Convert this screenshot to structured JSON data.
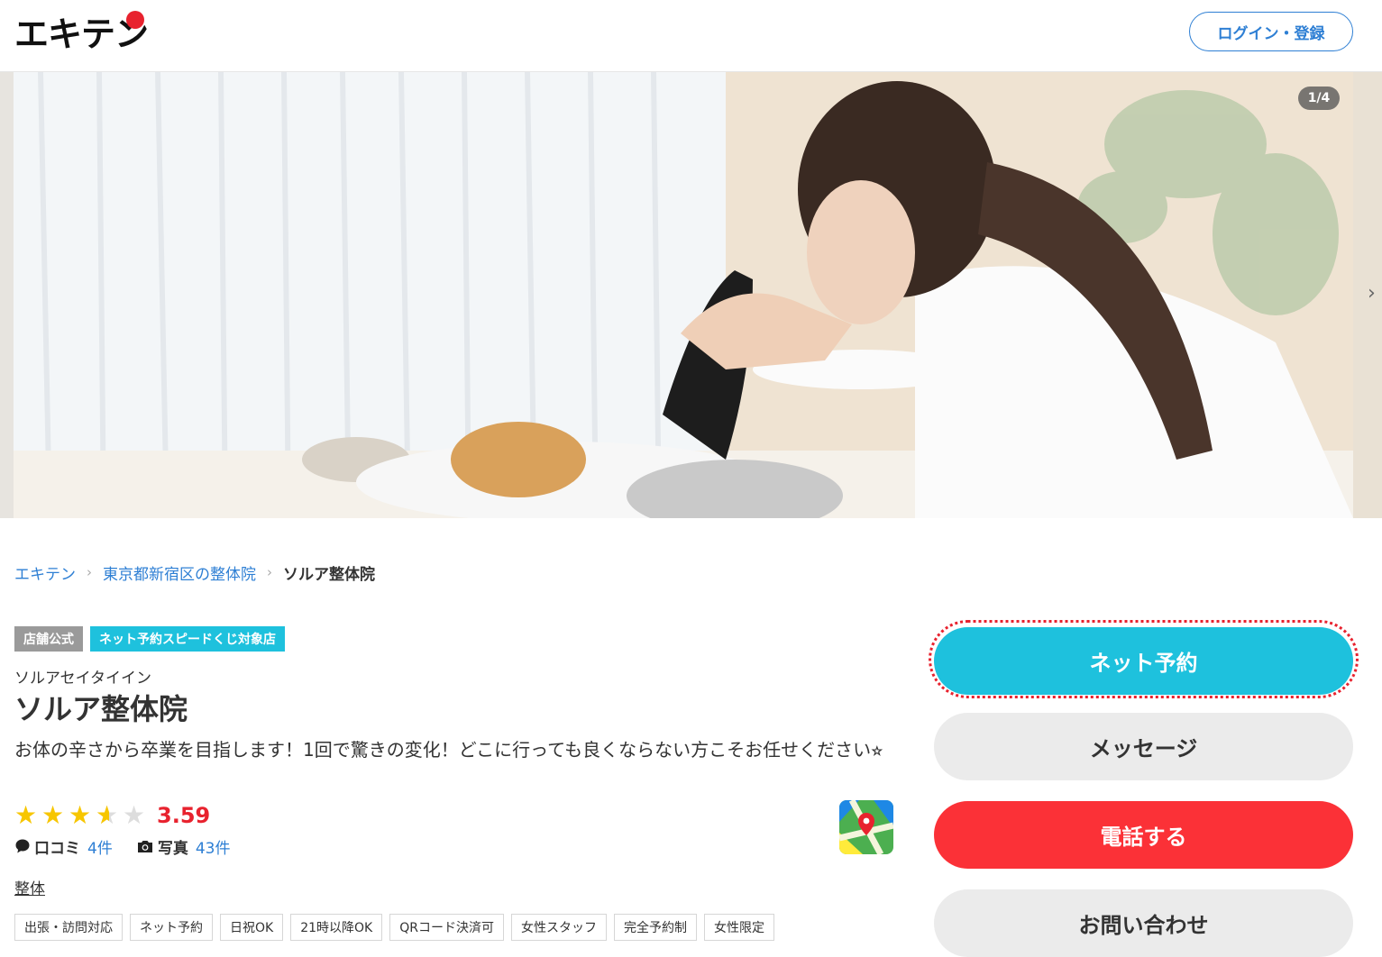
{
  "header": {
    "logo_text": "エキテン",
    "login_label": "ログイン・登録"
  },
  "hero": {
    "counter": "1/4",
    "next_glyph": "›"
  },
  "breadcrumb": {
    "items": [
      "エキテン",
      "東京都新宿区の整体院"
    ],
    "current": "ソルア整体院",
    "separator": "›"
  },
  "badges": {
    "official": "店舗公式",
    "lottery": "ネット予約スピードくじ対象店"
  },
  "shop": {
    "kana": "ソルアセイタイイン",
    "name": "ソルア整体院",
    "catch": "お体の辛さから卒業を目指します！1回で驚きの変化！どこに行っても良くならない方こそお任せください⭐︎"
  },
  "rating": {
    "score": "3.59",
    "stars_filled_fraction": 0.718,
    "reviews_label": "口コミ",
    "reviews_count": "4件",
    "photos_label": "写真",
    "photos_count": "43件"
  },
  "category": "整体",
  "tags": [
    "出張・訪問対応",
    "ネット予約",
    "日祝OK",
    "21時以降OK",
    "QRコード決済可",
    "女性スタッフ",
    "完全予約制",
    "女性限定"
  ],
  "actions": {
    "reserve": "ネット予約",
    "message": "メッセージ",
    "phone": "電話する",
    "inquiry": "お問い合わせ"
  },
  "colors": {
    "brand_red": "#e8222e",
    "link_blue": "#2e7fd4",
    "reserve_cyan": "#1ec1dd",
    "phone_red": "#fb3137",
    "star_yellow": "#f7c600"
  }
}
